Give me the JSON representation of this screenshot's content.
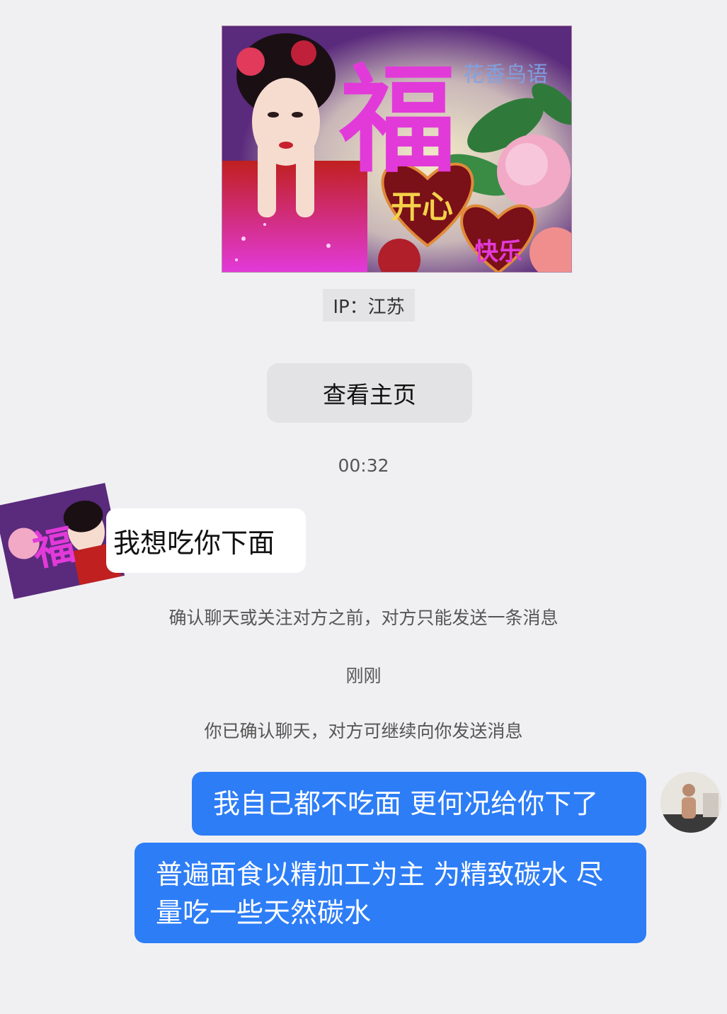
{
  "profile_card": {
    "watermark": "花香鸟语",
    "big_char": "福",
    "heart_text_1": "开心",
    "heart_text_2": "快乐",
    "colors": {
      "bg_purple": "#5a2a7c",
      "magenta": "#e23ad9",
      "red_dress": "#c0201f",
      "pink": "#f2a9c6"
    }
  },
  "ip_label": "IP：江苏",
  "homepage_button": "查看主页",
  "timestamp_1": "00:32",
  "incoming": {
    "avatar_char": "福",
    "message": "我想吃你下面"
  },
  "system_notes": {
    "limit_note": "确认聊天或关注对方之前，对方只能发送一条消息",
    "timestamp_2": "刚刚",
    "confirmed_note": "你已确认聊天，对方可继续向你发送消息"
  },
  "outgoing": {
    "message_1": "我自己都不吃面 更何况给你下了",
    "message_2_line_1": "普遍面食以精加工为主 为精致碳水 尽",
    "message_2_line_2": "量吃一些天然碳水",
    "bubble_color": "#2d7df6"
  }
}
